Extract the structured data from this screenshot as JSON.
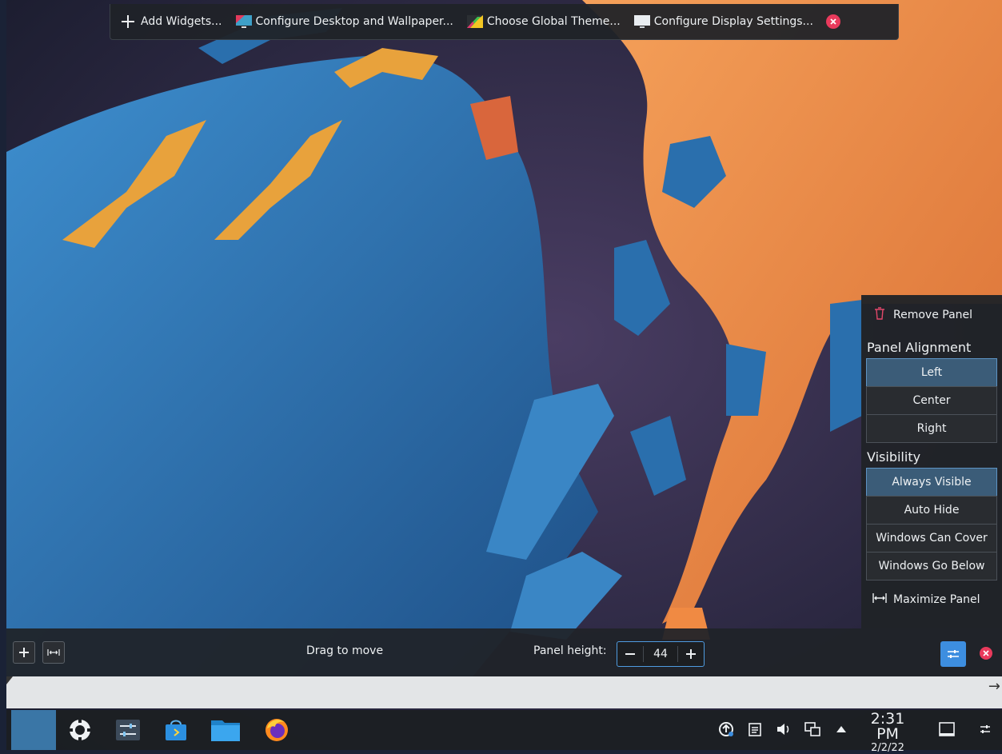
{
  "desktop_toolbar": {
    "add_widgets": "Add Widgets...",
    "configure_desktop": "Configure Desktop and Wallpaper...",
    "global_theme": "Choose Global Theme...",
    "display_settings": "Configure Display Settings..."
  },
  "panel_menu": {
    "remove_panel": "Remove Panel",
    "alignment_heading": "Panel Alignment",
    "alignment_options": [
      "Left",
      "Center",
      "Right"
    ],
    "alignment_selected": "Left",
    "visibility_heading": "Visibility",
    "visibility_options": [
      "Always Visible",
      "Auto Hide",
      "Windows Can Cover",
      "Windows Go Below"
    ],
    "visibility_selected": "Always Visible",
    "maximize_panel": "Maximize Panel"
  },
  "panel_controller": {
    "drag_label": "Drag to move",
    "height_label": "Panel height:",
    "height_value": "44"
  },
  "taskbar": {
    "time": "2:31 PM",
    "date": "2/2/22",
    "tasks": [
      "application-launcher-icon",
      "system-settings-icon",
      "discover-icon",
      "dolphin-icon",
      "firefox-icon"
    ],
    "tray": [
      "update-icon",
      "clipboard-icon",
      "volume-icon",
      "network-icon",
      "tray-expand-icon"
    ]
  },
  "colors": {
    "accent": "#3d8ee0",
    "close_red": "#e93a5c",
    "active_button": "#3b5c78",
    "wallpaper_blue": "#2f79b6",
    "wallpaper_orange": "#f08a43"
  }
}
